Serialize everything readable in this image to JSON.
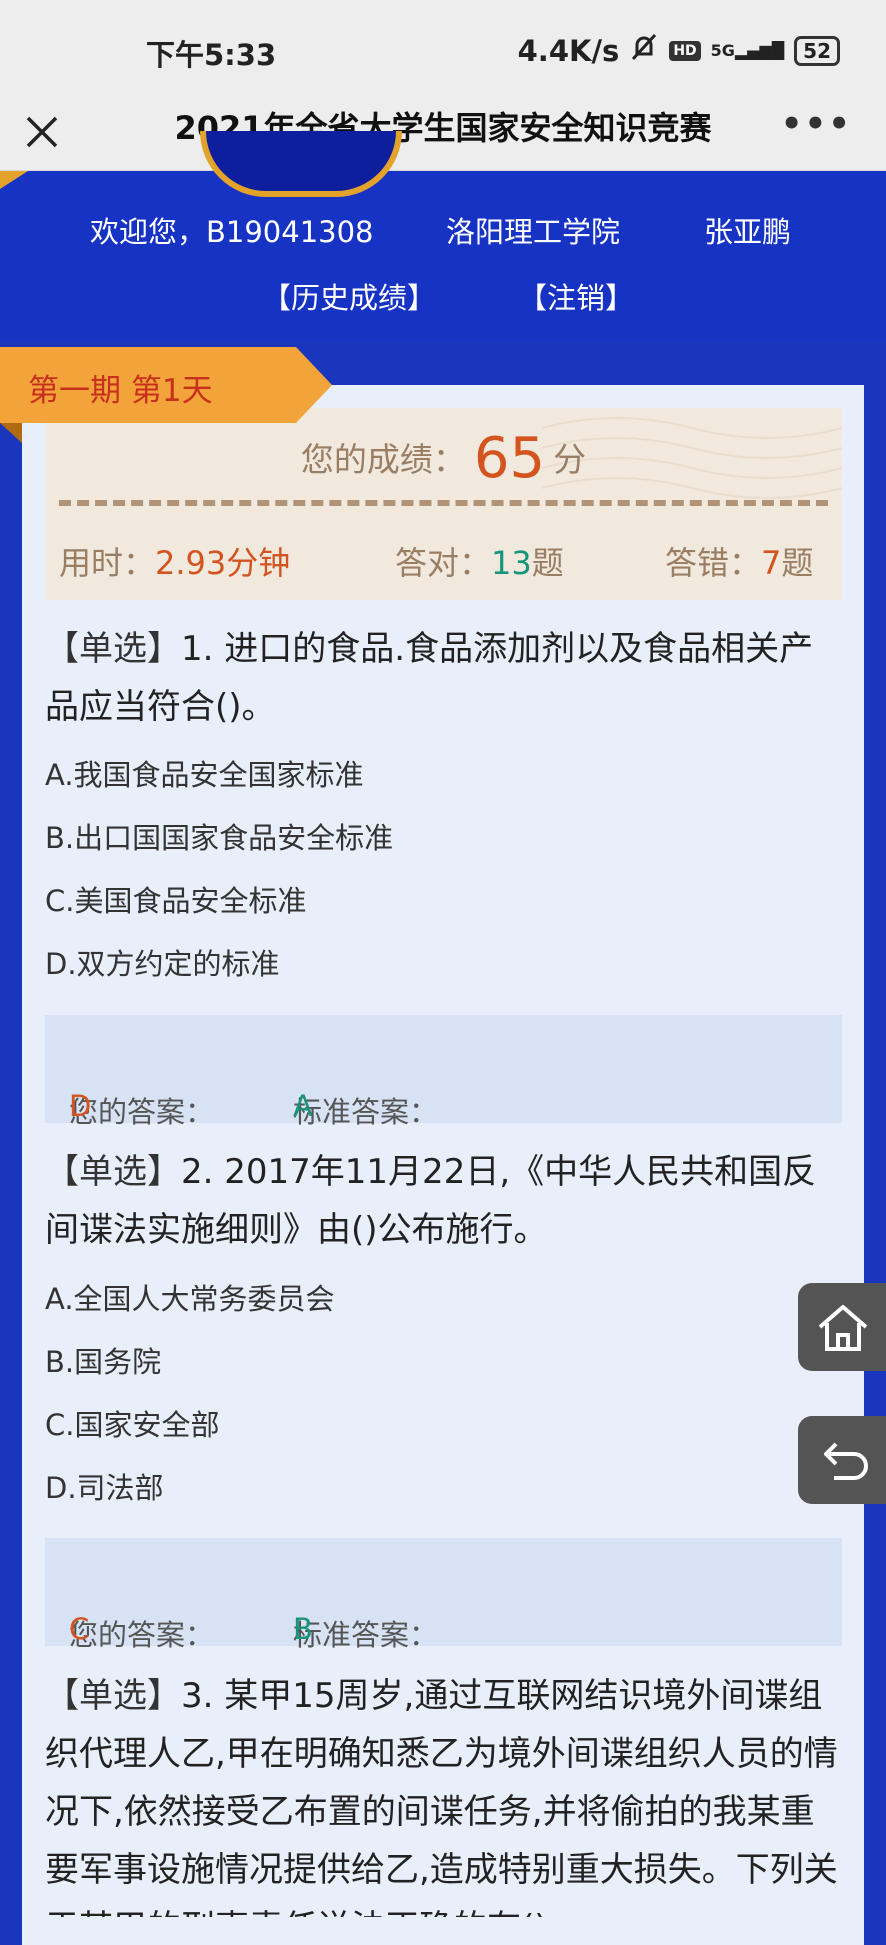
{
  "status_bar": {
    "time": "下午5:33",
    "speed": "4.4K/s",
    "network": "5G",
    "battery": "52"
  },
  "title_bar": {
    "title": "2021年全省大学生国家安全知识竞赛",
    "more": "•••"
  },
  "user": {
    "welcome": "欢迎您，B19041308",
    "school": "洛阳理工学院",
    "name": "张亚鹏"
  },
  "links": {
    "history": "【历史成绩】",
    "logout": "【注销】"
  },
  "period_tag": "第一期 第1天",
  "score": {
    "label": "您的成绩：",
    "value": "65",
    "unit": "分",
    "time_label": "用时：",
    "time_value": "2.93分钟",
    "correct_label": "答对：",
    "correct_value": "13",
    "wrong_label": "答错：",
    "wrong_value": "7",
    "count_unit": "题"
  },
  "questions": [
    {
      "type": "【单选】",
      "number": "1.",
      "text": "进口的食品.食品添加剂以及食品相关产品应当符合()。",
      "options": [
        "A.我国食品安全国家标准",
        "B.出口国国家食品安全标准",
        "C.美国食品安全标准",
        "D.双方约定的标准"
      ],
      "your_answer_label": "您的答案：",
      "your_answer": "D",
      "standard_answer_label": "标准答案：",
      "standard_answer": "A"
    },
    {
      "type": "【单选】",
      "number": "2.",
      "text": "2017年11月22日,《中华人民共和国反间谍法实施细则》由()公布施行。",
      "options": [
        "A.全国人大常务委员会",
        "B.国务院",
        "C.国家安全部",
        "D.司法部"
      ],
      "your_answer_label": "您的答案：",
      "your_answer": "C",
      "standard_answer_label": "标准答案：",
      "standard_answer": "B"
    },
    {
      "type": "【单选】",
      "number": "3.",
      "text": "某甲15周岁,通过互联网结识境外间谍组织代理人乙,甲在明确知悉乙为境外间谍组织人员的情况下,依然接受乙布置的间谍任务,并将偷拍的我某重要军事设施情况提供给乙,造成特别重大损失。下列关于某甲的刑事责任说法正确的有()"
    }
  ],
  "colors": {
    "page_bg": "#1a36bd",
    "card_bg": "#e8effa",
    "accent_orange": "#f2a43a",
    "answer_red": "#d4541f",
    "answer_green": "#16957b"
  },
  "icons": {
    "home": "home-icon",
    "back": "back-icon",
    "close": "close-icon",
    "mute": "bell-off-icon"
  }
}
